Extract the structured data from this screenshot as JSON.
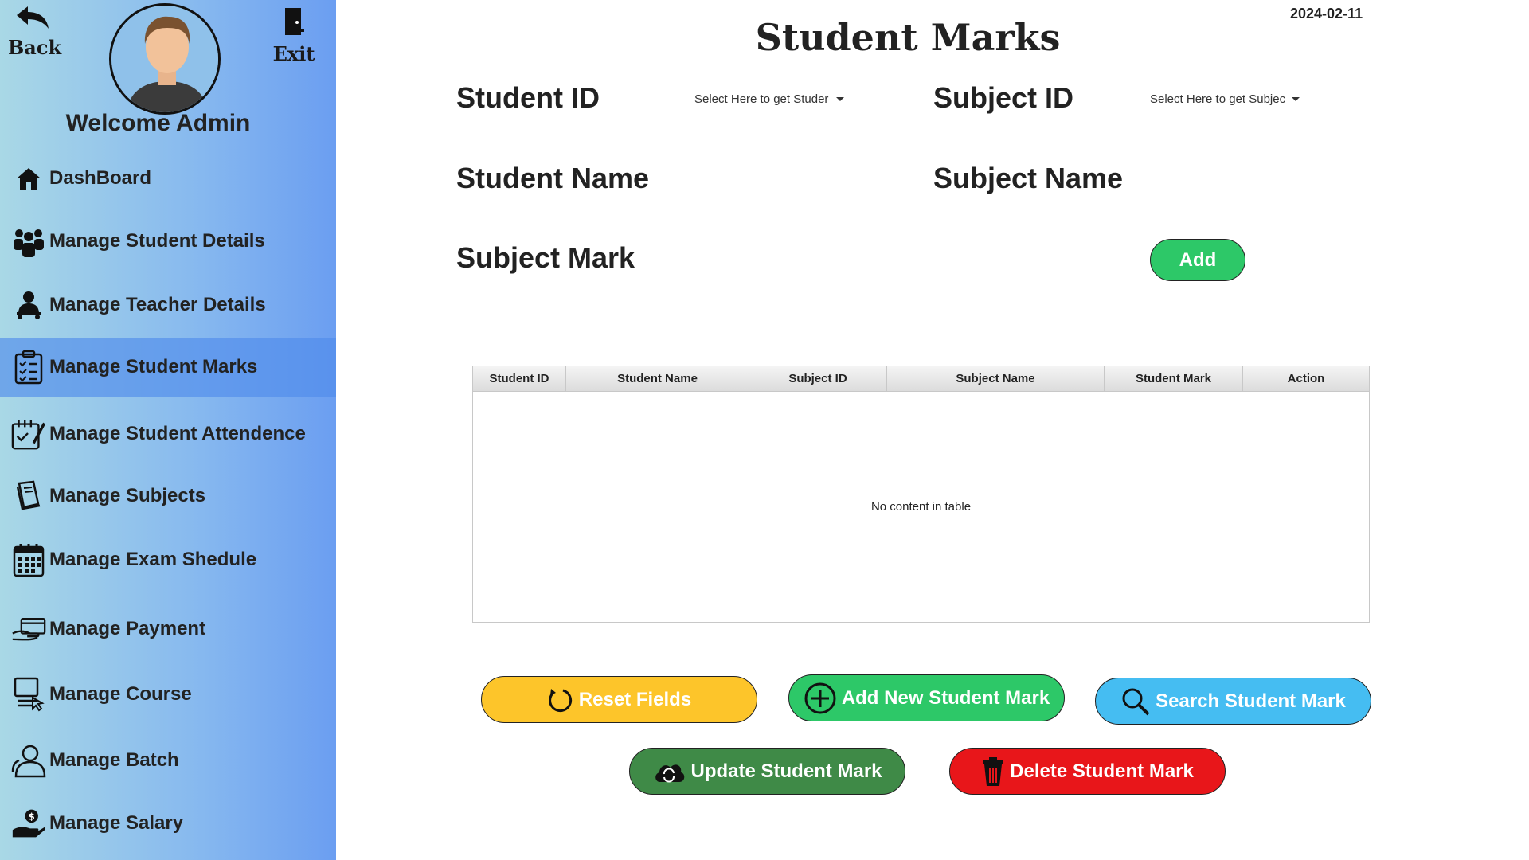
{
  "sidebar": {
    "back_label": "Back",
    "exit_label": "Exit",
    "welcome": "Welcome Admin",
    "items": [
      {
        "label": "DashBoard",
        "icon": "home-icon"
      },
      {
        "label": "Manage Student Details",
        "icon": "students-group-icon"
      },
      {
        "label": "Manage Teacher Details",
        "icon": "teacher-icon"
      },
      {
        "label": "Manage Student Marks",
        "icon": "clipboard-list-icon",
        "active": true
      },
      {
        "label": "Manage Student Attendence",
        "icon": "attendance-icon"
      },
      {
        "label": "Manage Subjects",
        "icon": "book-icon"
      },
      {
        "label": "Manage Exam Shedule",
        "icon": "calendar-icon"
      },
      {
        "label": "Manage Payment",
        "icon": "payment-hand-icon"
      },
      {
        "label": "Manage Course",
        "icon": "course-icon"
      },
      {
        "label": "Manage Batch",
        "icon": "batch-user-icon"
      },
      {
        "label": "Manage Salary",
        "icon": "salary-hand-icon"
      }
    ]
  },
  "header": {
    "date": "2024-02-11",
    "title": "Student Marks"
  },
  "form": {
    "student_id_label": "Student ID",
    "student_id_placeholder": "Select Here to get Studer",
    "subject_id_label": "Subject ID",
    "subject_id_placeholder": "Select Here to get Subjec",
    "student_name_label": "Student Name",
    "subject_name_label": "Subject Name",
    "subject_mark_label": "Subject Mark",
    "subject_mark_value": "",
    "add_label": "Add"
  },
  "table": {
    "columns": [
      "Student ID",
      "Student Name",
      "Subject ID",
      "Subject Name",
      "Student Mark",
      "Action"
    ],
    "rows": [],
    "empty_message": "No content in table"
  },
  "actions": {
    "reset": "Reset Fields",
    "add_new": "Add New Student Mark",
    "search": "Search Student Mark",
    "update": "Update Student Mark",
    "delete": "Delete Student Mark"
  },
  "colors": {
    "sidebar_start": "#a9d8e6",
    "sidebar_end": "#6b9ef1",
    "reset": "#fdc52a",
    "add": "#2dc868",
    "search": "#45bdf2",
    "update": "#3f8a47",
    "delete": "#e8161a"
  }
}
